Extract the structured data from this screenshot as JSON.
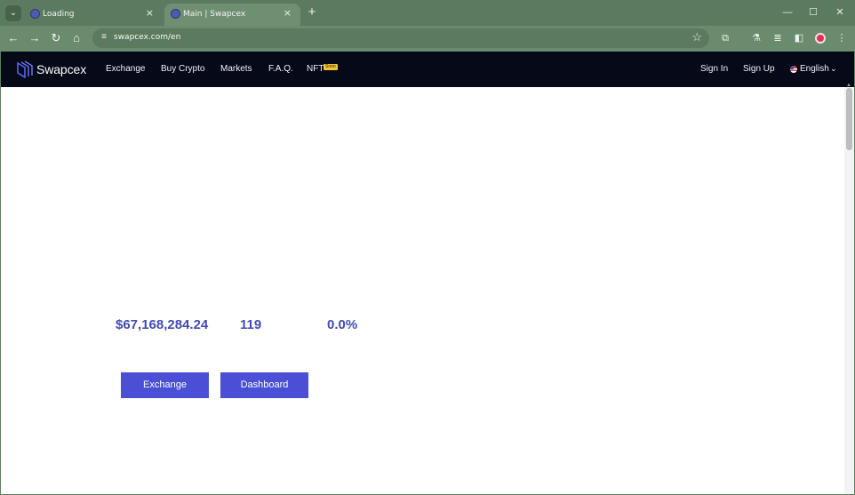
{
  "browser": {
    "tabs": [
      {
        "title": "Loading",
        "active": false
      },
      {
        "title": "Main | Swapcex",
        "active": true
      }
    ],
    "url": "swapcex.com/en",
    "icons": {
      "tab_search": "chevron-down-icon",
      "new_tab": "plus-icon",
      "close_tab": "close-icon",
      "minimize": "minimize-icon",
      "maximize": "maximize-icon",
      "close_window": "close-window-icon",
      "back": "back-arrow-icon",
      "forward": "forward-arrow-icon",
      "reload": "reload-icon",
      "home": "home-icon",
      "site_info": "tune-icon",
      "bookmark": "star-icon",
      "extensions": "puzzle-icon",
      "labs": "flask-icon",
      "media": "media-control-icon",
      "side_panel": "side-panel-icon",
      "menu": "kebab-menu-icon"
    },
    "colors": {
      "frame": "#5b7b60",
      "toolbar": "#6b8b6f",
      "profile": "#e62d52"
    }
  },
  "site": {
    "brand": "Swapcex",
    "nav": {
      "exchange": "Exchange",
      "buy_crypto": "Buy Crypto",
      "markets": "Markets",
      "faq": "F.A.Q.",
      "nft": "NFT",
      "nft_badge": "Soon",
      "sign_in": "Sign In",
      "sign_up": "Sign Up",
      "language": "English"
    },
    "stats": {
      "volume": "$67,168,284.24",
      "count": "119",
      "percent": "0.0%"
    },
    "buttons": {
      "exchange": "Exchange",
      "dashboard": "Dashboard"
    },
    "colors": {
      "nav_bg": "#050918",
      "accent": "#4a4fd6",
      "stat_text": "#4349b6",
      "badge": "#f4c432"
    }
  }
}
